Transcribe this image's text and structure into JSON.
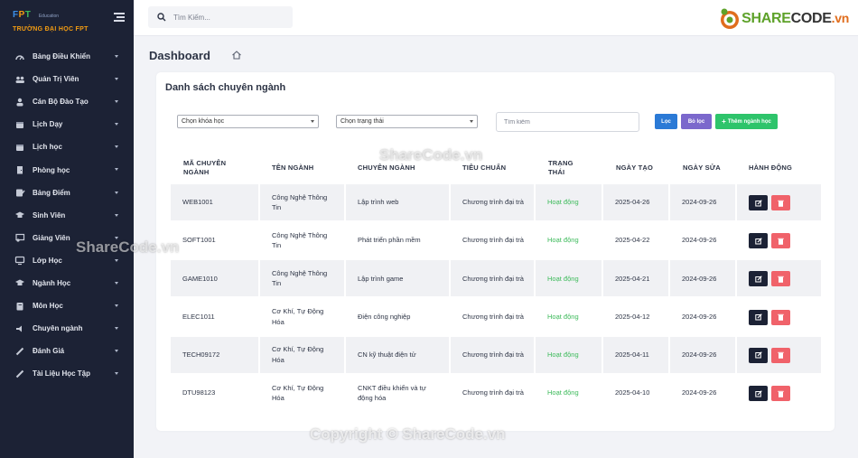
{
  "sidebar": {
    "logo_brand": "FPT",
    "logo_sub": "Education",
    "logo_school": "TRƯỜNG ĐẠI HỌC FPT",
    "items": [
      {
        "label": "Bảng Điều Khiển",
        "icon": "dashboard-icon"
      },
      {
        "label": "Quản Trị Viên",
        "icon": "users-icon"
      },
      {
        "label": "Cán Bộ Đào Tạo",
        "icon": "staff-icon"
      },
      {
        "label": "Lịch Dạy",
        "icon": "calendar-icon"
      },
      {
        "label": "Lịch học",
        "icon": "calendar-icon"
      },
      {
        "label": "Phòng học",
        "icon": "room-icon"
      },
      {
        "label": "Bảng Điểm",
        "icon": "grades-icon"
      },
      {
        "label": "Sinh Viên",
        "icon": "graduation-cap-icon"
      },
      {
        "label": "Giảng Viên",
        "icon": "teacher-icon"
      },
      {
        "label": "Lớp Học",
        "icon": "monitor-icon"
      },
      {
        "label": "Ngành Học",
        "icon": "graduation-cap-icon"
      },
      {
        "label": "Môn Học",
        "icon": "book-icon"
      },
      {
        "label": "Chuyên ngành",
        "icon": "speaker-icon"
      },
      {
        "label": "Đánh Giá",
        "icon": "pencil-icon"
      },
      {
        "label": "Tài Liệu Học Tập",
        "icon": "pencil-icon"
      }
    ]
  },
  "topbar": {
    "search_placeholder": "Tìm Kiếm...",
    "logo_text_a": "SHARE",
    "logo_text_b": "CODE",
    "logo_text_c": ".vn"
  },
  "page": {
    "title": "Dashboard"
  },
  "card": {
    "title": "Danh sách chuyên ngành",
    "filters": {
      "course_select": "Chọn khóa học",
      "status_select": "Chọn trạng thái",
      "search_placeholder": "Tìm kiếm",
      "filter_label": "Lọc",
      "clear_label": "Bỏ lọc",
      "add_label": "Thêm ngành học"
    },
    "columns": [
      "MÃ CHUYÊN NGÀNH",
      "TÊN NGÀNH",
      "CHUYÊN NGÀNH",
      "TIÊU CHUẨN",
      "TRẠNG THÁI",
      "NGÀY TẠO",
      "NGÀY SỬA",
      "HÀNH ĐỘNG"
    ],
    "rows": [
      {
        "code": "WEB1001",
        "name": "Công Nghệ Thông Tin",
        "major": "Lập trình web",
        "standard": "Chương trình đại trà",
        "status": "Hoạt động",
        "created": "2025-04-26",
        "updated": "2024-09-26"
      },
      {
        "code": "SOFT1001",
        "name": "Công Nghệ Thông Tin",
        "major": "Phát triển phần mềm",
        "standard": "Chương trình đại trà",
        "status": "Hoạt động",
        "created": "2025-04-22",
        "updated": "2024-09-26"
      },
      {
        "code": "GAME1010",
        "name": "Công Nghệ Thông Tin",
        "major": "Lập trình game",
        "standard": "Chương trình đại trà",
        "status": "Hoạt động",
        "created": "2025-04-21",
        "updated": "2024-09-26"
      },
      {
        "code": "ELEC1011",
        "name": "Cơ Khí, Tự Động Hóa",
        "major": "Điện công nghiệp",
        "standard": "Chương trình đại trà",
        "status": "Hoạt động",
        "created": "2025-04-12",
        "updated": "2024-09-26"
      },
      {
        "code": "TECH09172",
        "name": "Cơ Khí, Tự Động Hóa",
        "major": "CN kỹ thuật điện tử",
        "standard": "Chương trình đại trà",
        "status": "Hoạt động",
        "created": "2025-04-11",
        "updated": "2024-09-26"
      },
      {
        "code": "DTU98123",
        "name": "Cơ Khí, Tự Động Hóa",
        "major": "CNKT điều khiển và tự động hóa",
        "standard": "Chương trình đại trà",
        "status": "Hoạt động",
        "created": "2025-04-10",
        "updated": "2024-09-26"
      }
    ]
  },
  "watermarks": [
    "ShareCode.vn",
    "ShareCode.vn",
    "Copyright © ShareCode.vn"
  ],
  "colors": {
    "sidebar_bg": "#1c2235",
    "status_green": "#3cba5a",
    "primary": "#2b7ad6",
    "violet": "#7b68cc",
    "success": "#2ec46b",
    "danger": "#f0626a"
  }
}
